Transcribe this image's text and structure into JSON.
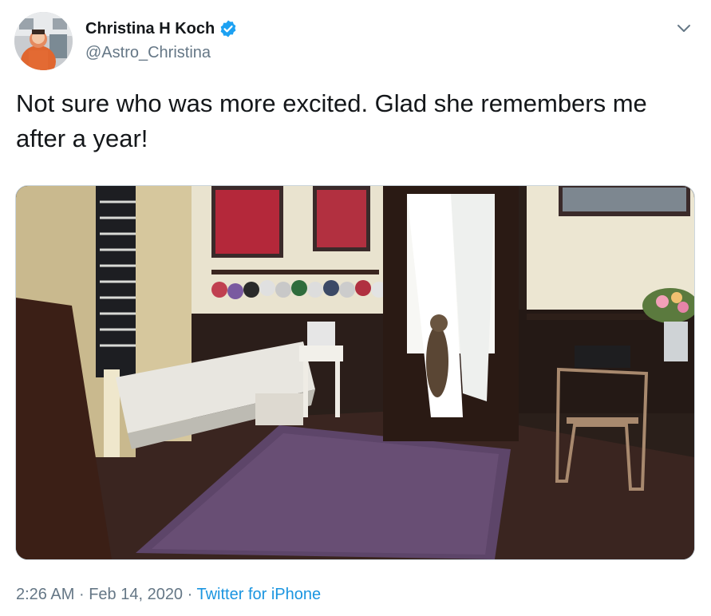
{
  "tweet": {
    "author": {
      "display_name": "Christina H Koch",
      "handle": "@Astro_Christina",
      "verified": true,
      "avatar_icon": "astronaut-avatar"
    },
    "text": "Not sure who was more excited. Glad she remembers me after a year!",
    "media": {
      "type": "video",
      "description_icon": "video-thumbnail"
    },
    "time": "2:26 AM",
    "separator": "·",
    "date": "Feb 14, 2020",
    "source": "Twitter for iPhone"
  },
  "colors": {
    "text": "#14171a",
    "secondary": "#657786",
    "link": "#1b95e0",
    "verified_badge": "#1da1f2",
    "border": "#ccd6dd"
  }
}
